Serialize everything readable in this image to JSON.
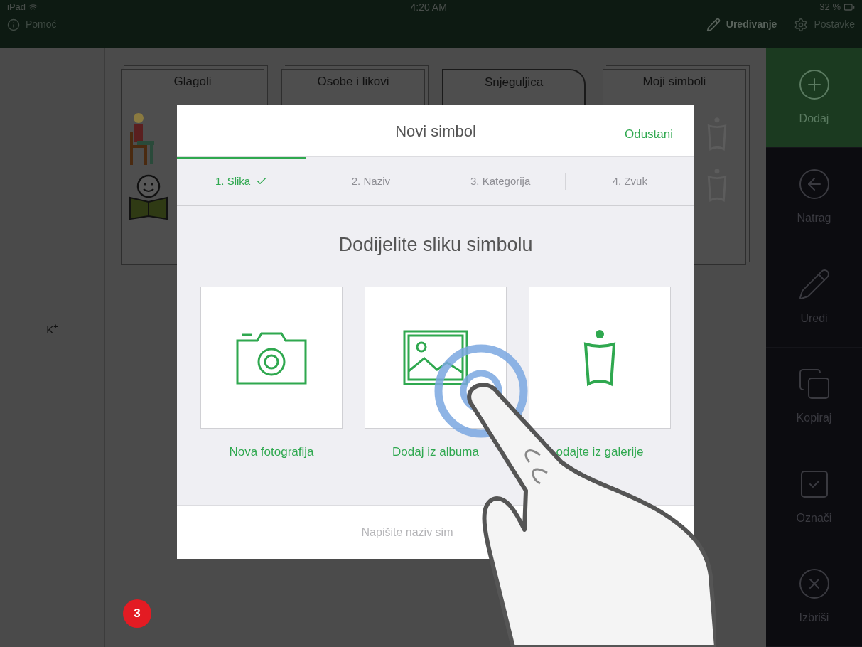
{
  "status_bar": {
    "device": "iPad",
    "time": "4:20 AM",
    "battery": "32 %"
  },
  "toolbar": {
    "help": "Pomoć",
    "edit": "Uredivanje",
    "settings": "Postavke"
  },
  "left_panel": {
    "label": "K$^{+}$"
  },
  "categories": [
    {
      "label": "Glagoli",
      "selected": false,
      "kind": "people"
    },
    {
      "label": "Osobe i likovi",
      "selected": false,
      "kind": "empty"
    },
    {
      "label": "Snjeguljica",
      "selected": true,
      "kind": "empty"
    },
    {
      "label": "Moji simboli",
      "selected": false,
      "kind": "gallery"
    }
  ],
  "dialog": {
    "title": "Novi simbol",
    "cancel": "Odustani",
    "steps": [
      {
        "label": "1. Slika",
        "selected": true,
        "done": true
      },
      {
        "label": "2. Naziv",
        "selected": false,
        "done": false
      },
      {
        "label": "3. Kategorija",
        "selected": false,
        "done": false
      },
      {
        "label": "4. Zvuk",
        "selected": false,
        "done": false
      }
    ],
    "heading": "Dodijelite sliku simbolu",
    "options": [
      {
        "label": "Nova fotografija",
        "kind": "camera"
      },
      {
        "label": "Dodaj iz albuma",
        "kind": "album"
      },
      {
        "label": "odajte iz galerije",
        "kind": "gallery"
      }
    ],
    "name_placeholder": "Napišite naziv sim"
  },
  "actions": [
    {
      "label": "Dodaj",
      "kind": "add",
      "selected": true
    },
    {
      "label": "Natrag",
      "kind": "back",
      "selected": false
    },
    {
      "label": "Uredi",
      "kind": "edit",
      "selected": false
    },
    {
      "label": "Kopiraj",
      "kind": "copy",
      "selected": false
    },
    {
      "label": "Označi",
      "kind": "mark",
      "selected": false
    },
    {
      "label": "Izbriši",
      "kind": "delete",
      "selected": false
    }
  ],
  "step_badge": "3"
}
